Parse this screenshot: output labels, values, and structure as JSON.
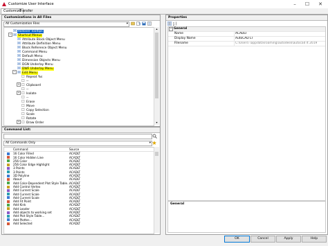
{
  "window": {
    "title": "Customize User Interface"
  },
  "tabs": [
    {
      "label": "Customize"
    },
    {
      "label": "Transfer"
    }
  ],
  "customizations": {
    "header": "Customizations in All Files",
    "filter_value": "All Customization Files",
    "tree": [
      {
        "label": "Rollover Tooltips",
        "depth": 1,
        "highlight": "selected"
      },
      {
        "label": "Shortcut Menus",
        "depth": 1,
        "highlight": "yellow",
        "expander": "−"
      },
      {
        "label": "Attribute Block Object Menu",
        "depth": 2
      },
      {
        "label": "Attribute Definition Menu",
        "depth": 2
      },
      {
        "label": "Block Reference Object Menu",
        "depth": 2
      },
      {
        "label": "Command Menu",
        "depth": 2
      },
      {
        "label": "Default Menu",
        "depth": 2
      },
      {
        "label": "Dimension Objects Menu",
        "depth": 2
      },
      {
        "label": "DGN Underlay Menu",
        "depth": 2
      },
      {
        "label": "DWF Underlay Menu",
        "depth": 2,
        "highlight": "yellow"
      },
      {
        "label": "Edit Menu",
        "depth": 2,
        "highlight": "yellow",
        "expander": "−"
      },
      {
        "label": "Repeat %s",
        "depth": 3
      },
      {
        "label": "--",
        "depth": 3
      },
      {
        "label": "Clipboard",
        "depth": 3,
        "expander": "+"
      },
      {
        "label": "--",
        "depth": 3
      },
      {
        "label": "Isolate",
        "depth": 3,
        "expander": "+"
      },
      {
        "label": "--",
        "depth": 3
      },
      {
        "label": "Erase",
        "depth": 3
      },
      {
        "label": "Move",
        "depth": 3
      },
      {
        "label": "Copy Selection",
        "depth": 3
      },
      {
        "label": "Scale",
        "depth": 3
      },
      {
        "label": "Rotate",
        "depth": 3
      },
      {
        "label": "Draw Order",
        "depth": 3,
        "expander": "+"
      }
    ]
  },
  "command_list": {
    "header": "Command List:",
    "filter_value": "All Commands Only",
    "columns": {
      "command": "Command",
      "source": "Source"
    },
    "rows": [
      {
        "command": "16 Color Filled",
        "source": "ACADLT"
      },
      {
        "command": "16 Color Hidden Line",
        "source": "ACADLT"
      },
      {
        "command": "256 Color",
        "source": "ACADLT"
      },
      {
        "command": "256 Color Edge Highlight",
        "source": "ACADLT"
      },
      {
        "command": "3 Points",
        "source": "ACADLT"
      },
      {
        "command": "3 Points",
        "source": "ACADLT"
      },
      {
        "command": "3D Polyline",
        "source": "ACADLT"
      },
      {
        "command": "About",
        "source": "ACADLT"
      },
      {
        "command": "Add Color-Dependent Plot Style Table...",
        "source": "ACADLT"
      },
      {
        "command": "Add Control Vertex",
        "source": "ACADLT"
      },
      {
        "command": "Add Current Scale",
        "source": "ACADLT"
      },
      {
        "command": "Add Current Scale",
        "source": "ACADLT"
      },
      {
        "command": "Add Current Scale",
        "source": "ACADLT"
      },
      {
        "command": "Add Fit Point",
        "source": "ACADLT"
      },
      {
        "command": "Add Kink",
        "source": "ACADLT"
      },
      {
        "command": "Add Leader",
        "source": "ACADLT"
      },
      {
        "command": "Add objects to working set",
        "source": "ACADLT"
      },
      {
        "command": "Add Plot Style Table...",
        "source": "ACADLT"
      },
      {
        "command": "Add Plotter...",
        "source": "ACADLT"
      },
      {
        "command": "Add Selected",
        "source": "ACADLT"
      }
    ]
  },
  "properties": {
    "header": "Properties",
    "category": "General",
    "rows": [
      {
        "key": "Name",
        "value": "ACADLT"
      },
      {
        "key": "Display Name",
        "value": "AutoCAD LT"
      },
      {
        "key": "Filename",
        "value": "C:\\Users\\ \\appdata\\roaming\\autodesk\\autocad lt 2019\\r22"
      }
    ],
    "description_title": "General"
  },
  "buttons": {
    "ok": "OK",
    "cancel": "Cancel",
    "apply": "Apply",
    "help": "Help"
  },
  "colors": {
    "highlight": "#ffff00",
    "selection": "#0a64c8",
    "accent": "#0078d7"
  }
}
